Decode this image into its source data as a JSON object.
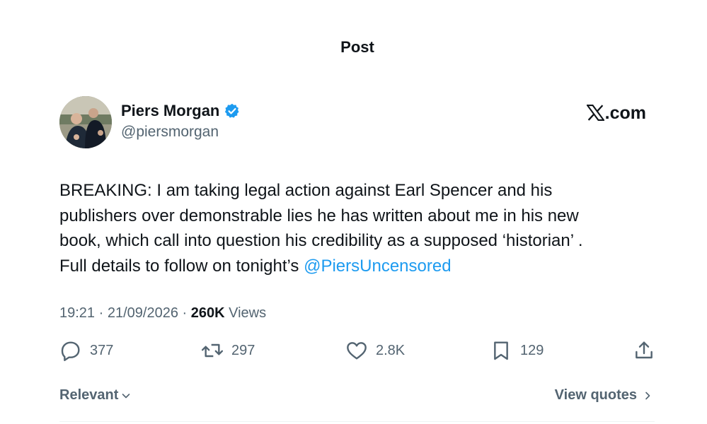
{
  "header": {
    "title": "Post"
  },
  "author": {
    "display_name": "Piers Morgan",
    "handle": "@piersmorgan",
    "verified": true
  },
  "brand": {
    "text": ".com"
  },
  "tweet": {
    "text_lines": [
      "BREAKING: I am taking legal action against Earl Spencer and his",
      "publishers over demonstrable lies he has written about me in his new",
      "book, which call into question his credibility as a supposed ‘historian’ ."
    ],
    "last_line_prefix": "Full details to follow on tonight’s ",
    "mention": "@PiersUncensored"
  },
  "meta": {
    "time": "19:21",
    "date": "21/09/2026",
    "views_count": "260K",
    "views_label": "Views",
    "separator": " · "
  },
  "actions": {
    "replies": "377",
    "reposts": "297",
    "likes": "2.8K",
    "bookmarks": "129"
  },
  "footer": {
    "sort_label": "Relevant",
    "view_quotes_label": "View quotes"
  },
  "colors": {
    "accent": "#1d9bf0",
    "muted": "#536471",
    "text": "#0f1419"
  }
}
